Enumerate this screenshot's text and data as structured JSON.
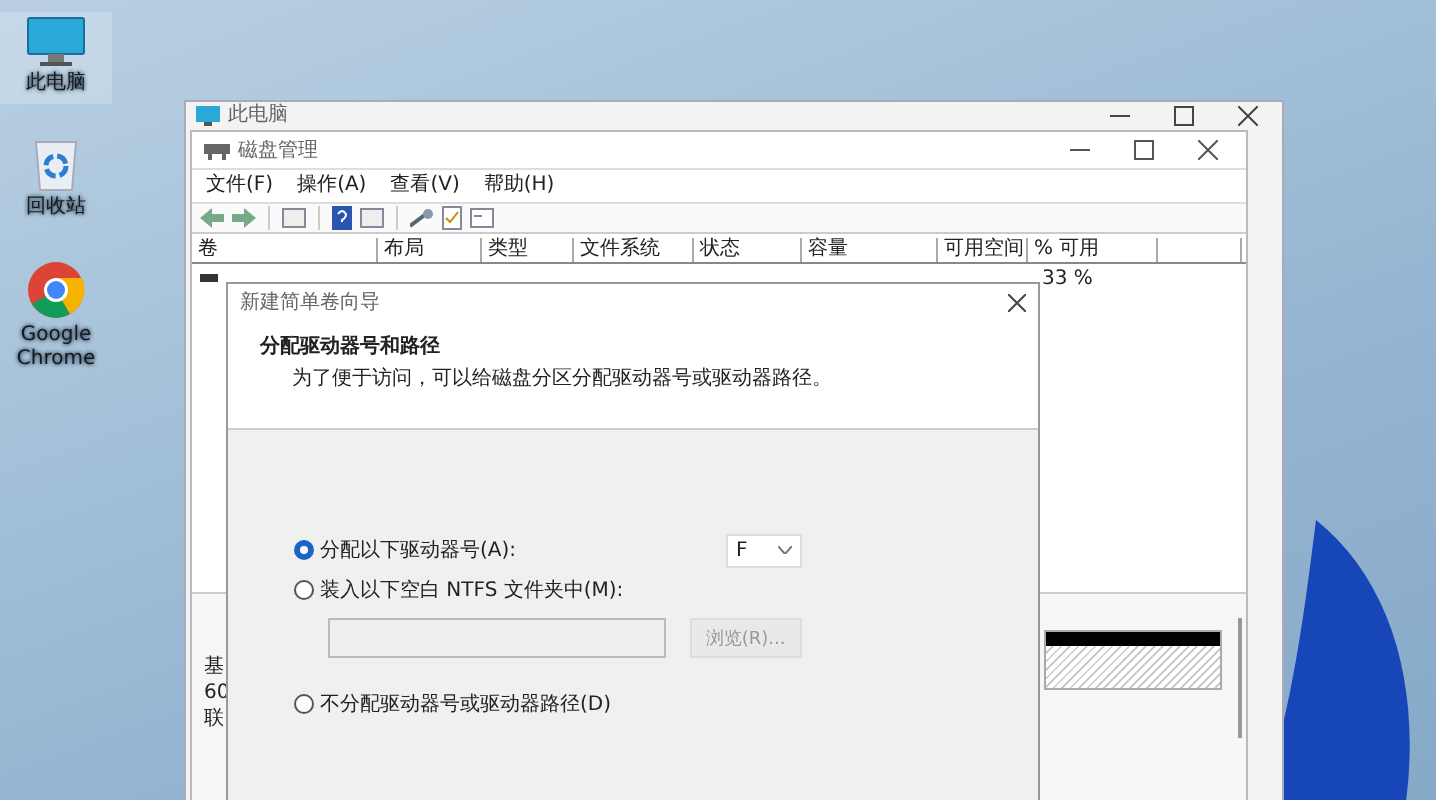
{
  "desktop_icons": [
    {
      "kind": "computer",
      "label": "此电脑"
    },
    {
      "kind": "recycle",
      "label": "回收站"
    },
    {
      "kind": "chrome",
      "label": "Google Chrome"
    }
  ],
  "explorer_window": {
    "title": "此电脑"
  },
  "disk_management": {
    "title": "磁盘管理",
    "menu": [
      "文件(F)",
      "操作(A)",
      "查看(V)",
      "帮助(H)"
    ],
    "columns": [
      "卷",
      "布局",
      "类型",
      "文件系统",
      "状态",
      "容量",
      "可用空间",
      "% 可用"
    ],
    "row": {
      "percent_free": "33 %"
    },
    "disk_labels": [
      "基",
      "60",
      "联"
    ]
  },
  "wizard": {
    "title": "新建简单卷向导",
    "heading": "分配驱动器号和路径",
    "description": "为了便于访问，可以给磁盘分区分配驱动器号或驱动器路径。",
    "options": [
      {
        "kind": "letter",
        "label": "分配以下驱动器号(A):",
        "selected": true
      },
      {
        "kind": "folder",
        "label": "装入以下空白 NTFS 文件夹中(M):",
        "selected": false
      },
      {
        "kind": "none",
        "label": "不分配驱动器号或驱动器路径(D)",
        "selected": false
      }
    ],
    "drive_letter": "F",
    "browse_button": {
      "label": "浏览(R)...",
      "disabled": true
    }
  }
}
